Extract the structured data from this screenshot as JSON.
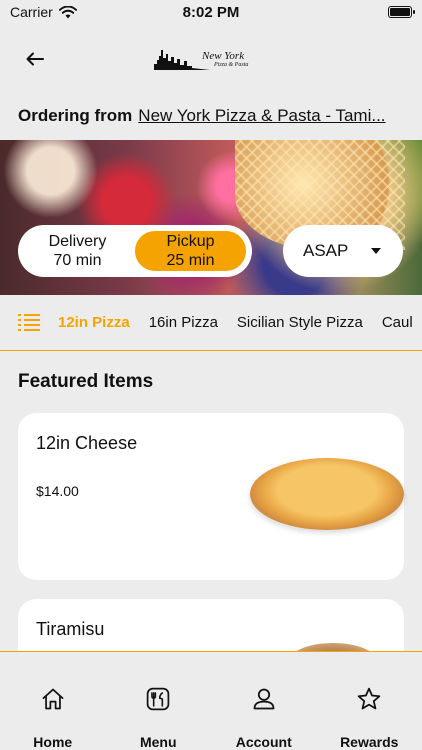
{
  "status_bar": {
    "carrier": "Carrier",
    "time": "8:02 PM",
    "battery_level": 1.0
  },
  "header": {
    "logo_line1": "New York",
    "logo_line2": "Pizza & Pasta"
  },
  "ordering": {
    "label": "Ordering from",
    "location": "New York Pizza & Pasta - Tami..."
  },
  "order_mode": {
    "delivery": {
      "label": "Delivery",
      "time": "70 min"
    },
    "pickup": {
      "label": "Pickup",
      "time": "25 min"
    },
    "selected": "pickup"
  },
  "schedule": {
    "value": "ASAP"
  },
  "categories": [
    "12in Pizza",
    "16in Pizza",
    "Sicilian Style Pizza",
    "Caul"
  ],
  "active_category": "12in Pizza",
  "featured": {
    "title": "Featured Items",
    "items": [
      {
        "name": "12in Cheese",
        "price": "$14.00"
      },
      {
        "name": "Tiramisu",
        "price": ""
      }
    ]
  },
  "tab_bar": [
    "Home",
    "Menu",
    "Account",
    "Rewards"
  ],
  "colors": {
    "accent": "#f5a300",
    "background": "#ececec",
    "card": "#ffffff"
  }
}
